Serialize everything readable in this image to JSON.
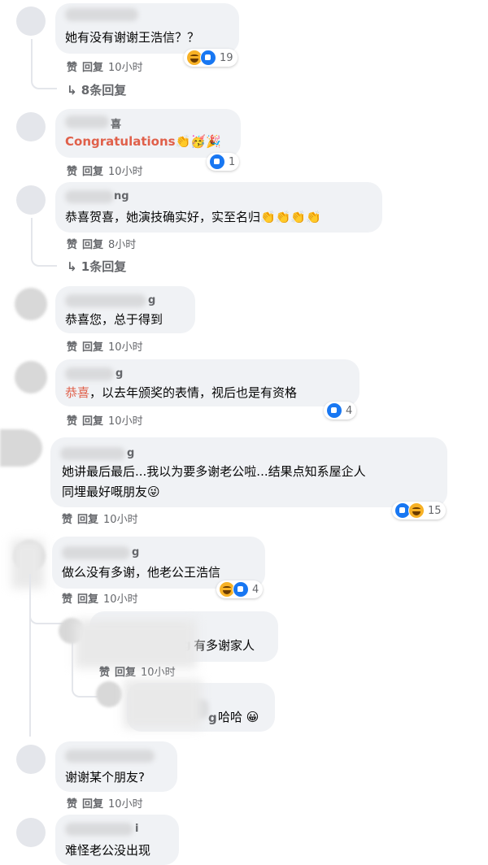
{
  "labels": {
    "like": "赞",
    "reply": "回复"
  },
  "comments": [
    {
      "text": "她有没有谢谢王浩信？？",
      "time": "10小时",
      "reaction_count": "19",
      "reaction_icons": [
        "haha-icon",
        "like-icon"
      ],
      "replies_link": "↳ 8条回复"
    },
    {
      "name": "喜",
      "text": "Congratulations",
      "emoji": "👏🥳🎉",
      "time": "10小时",
      "reaction_count": "1",
      "reaction_icons": [
        "like-icon"
      ]
    },
    {
      "name": "ng",
      "text": "恭喜贺喜，她演技确实好，实至名归",
      "emoji": "👏👏👏👏",
      "time": "8小时",
      "replies_link": "↳ 1条回复"
    },
    {
      "name": "g",
      "text": "恭喜您，总于得到",
      "time": "10小时"
    },
    {
      "name": "g",
      "text_accent": "恭喜",
      "text": "，以去年颁奖的表情，视后也是有资格",
      "time": "10小时",
      "reaction_count": "4",
      "reaction_icons": [
        "like-icon"
      ]
    },
    {
      "name": "g",
      "text_line1": "她讲最后最后...我以为要多谢老公啦...结果点知系屋企人",
      "text_line2": "同埋最好嘅朋友",
      "emoji": "😜",
      "time": "10小时",
      "reaction_count": "15",
      "reaction_icons": [
        "like-icon",
        "haha-icon"
      ]
    },
    {
      "name": "g",
      "text": "做么没有多谢，他老公王浩信",
      "time": "10小时",
      "reaction_count": "4",
      "reaction_icons": [
        "haha-icon",
        "like-icon"
      ]
    },
    {
      "name_part": "g",
      "text": "有多谢家人",
      "time": "10小时",
      "is_reply": true
    },
    {
      "name_part": "g",
      "text": "哈哈",
      "emoji": "😀",
      "is_reply": true
    },
    {
      "text": "谢谢某个朋友?",
      "time": "10小时"
    },
    {
      "name": "i",
      "text": "难怪老公没出现"
    }
  ]
}
